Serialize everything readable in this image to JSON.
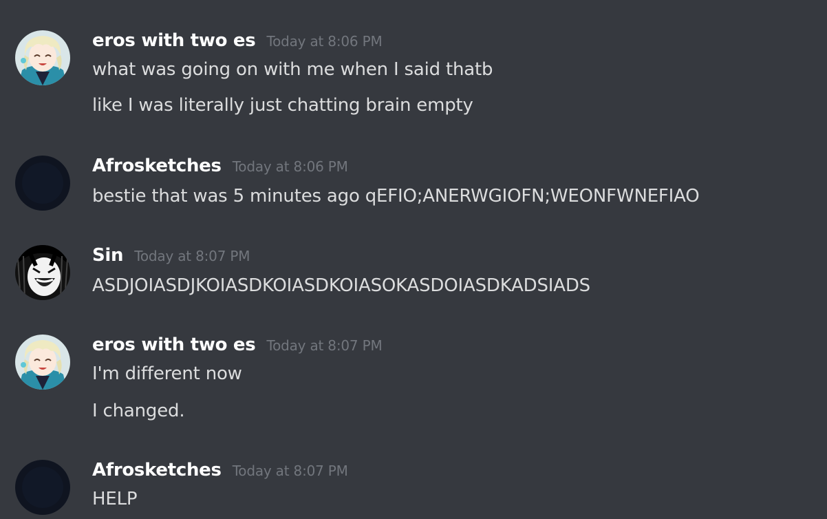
{
  "messages": [
    {
      "author": "eros with two es",
      "timestamp": "Today at 8:06 PM",
      "avatar_icon": "anime-avatar-icon",
      "lines": [
        "what was going on with me when I said thatb",
        "like I was literally just chatting brain empty"
      ]
    },
    {
      "author": "Afrosketches",
      "timestamp": "Today at 8:06 PM",
      "avatar_icon": "dark-avatar-icon",
      "lines": [
        "bestie that was 5 minutes ago qEFIO;ANERWGIOFN;WEONFWNEFIAO"
      ]
    },
    {
      "author": "Sin",
      "timestamp": "Today at 8:07 PM",
      "avatar_icon": "laughing-face-avatar-icon",
      "lines": [
        "ASDJOIASDJKOIASDKOIASDKOIASOKASDOIASDKADSIADS"
      ]
    },
    {
      "author": "eros with two es",
      "timestamp": "Today at 8:07 PM",
      "avatar_icon": "anime-avatar-icon",
      "lines": [
        "I'm different now",
        "I changed."
      ]
    },
    {
      "author": "Afrosketches",
      "timestamp": "Today at 8:07 PM",
      "avatar_icon": "dark-avatar-icon",
      "lines": [
        "HELP"
      ]
    }
  ],
  "colors": {
    "background": "#36393f",
    "username": "#ffffff",
    "timestamp": "#72767d",
    "message_text": "#dcddde"
  }
}
